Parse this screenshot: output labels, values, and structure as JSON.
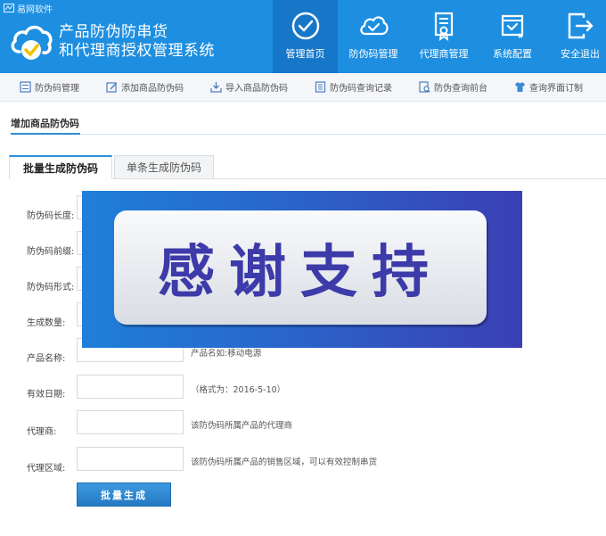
{
  "header": {
    "brand": "易网软件",
    "title_line1": "产品防伪防串货",
    "title_line2": "和代理商授权管理系统",
    "nav": [
      {
        "label": "管理首页",
        "icon": "check-circle-icon",
        "active": true
      },
      {
        "label": "防伪码管理",
        "icon": "cloud-check-icon",
        "active": false
      },
      {
        "label": "代理商管理",
        "icon": "certificate-icon",
        "active": false
      },
      {
        "label": "系统配置",
        "icon": "config-box-icon",
        "active": false
      },
      {
        "label": "安全退出",
        "icon": "logout-icon",
        "active": false
      }
    ],
    "bg_color": "#1e8fe0"
  },
  "subnav": [
    {
      "label": "防伪码管理",
      "icon": "list-icon"
    },
    {
      "label": "添加商品防伪码",
      "icon": "edit-icon"
    },
    {
      "label": "导入商品防伪码",
      "icon": "import-icon"
    },
    {
      "label": "防伪码查询记录",
      "icon": "record-icon"
    },
    {
      "label": "防伪查询前台",
      "icon": "search-page-icon"
    },
    {
      "label": "查询界面订制",
      "icon": "tshirt-icon"
    }
  ],
  "page": {
    "title": "增加商品防伪码",
    "tabs": [
      {
        "label": "批量生成防伪码",
        "active": true
      },
      {
        "label": "单条生成防伪码",
        "active": false
      }
    ]
  },
  "form": {
    "fields": [
      {
        "label": "防伪码长度:",
        "value": "",
        "hint": ""
      },
      {
        "label": "防伪码前缀:",
        "value": "",
        "hint": ""
      },
      {
        "label": "防伪码形式:",
        "value": "",
        "hint": ""
      },
      {
        "label": "生成数量:",
        "value": "",
        "hint": ""
      },
      {
        "label": "产品名称:",
        "value": "",
        "hint": "产品名如:移动电源"
      },
      {
        "label": "有效日期:",
        "value": "",
        "hint": "（格式为：2016-5-10）"
      },
      {
        "label": "代理商:",
        "value": "",
        "hint": "该防伪码所属产品的代理商"
      },
      {
        "label": "代理区域:",
        "value": "",
        "hint": "该防伪码所属产品的销售区域，可以有效控制串货"
      }
    ],
    "submit_label": "批量生成"
  },
  "overlay": {
    "text": "感谢支持"
  }
}
